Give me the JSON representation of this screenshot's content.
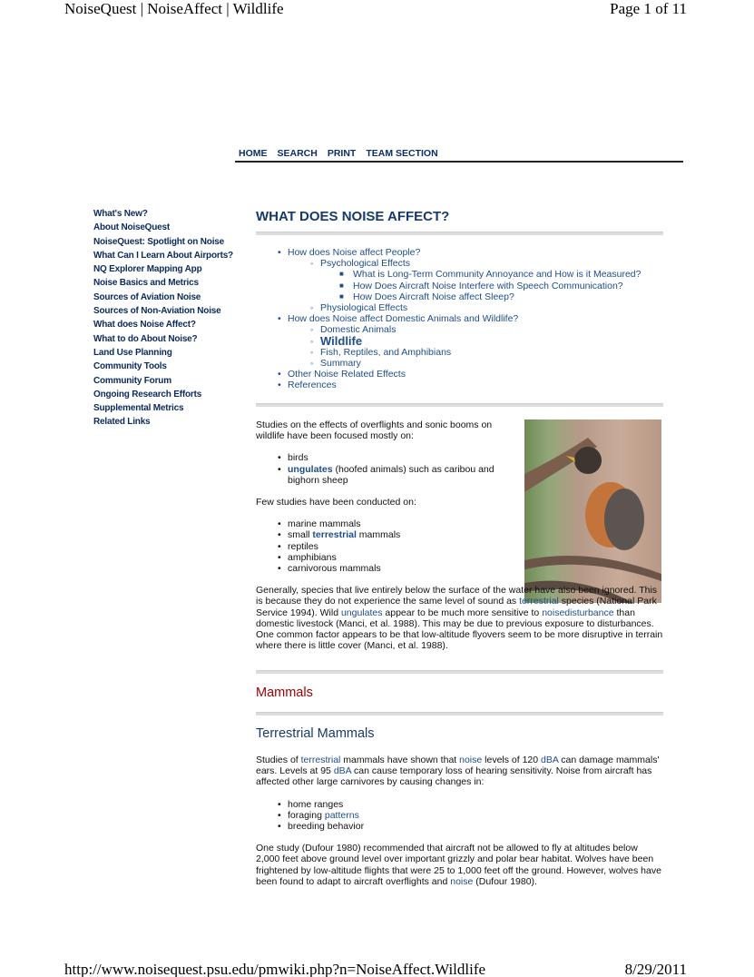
{
  "print_header": {
    "title": "NoiseQuest | NoiseAffect | Wildlife",
    "page": "Page 1 of 11"
  },
  "print_footer": {
    "url": "http://www.noisequest.psu.edu/pmwiki.php?n=NoiseAffect.Wildlife",
    "date": "8/29/2011"
  },
  "nav": [
    "HOME",
    "SEARCH",
    "PRINT",
    "TEAM SECTION"
  ],
  "sidebar": [
    "What's New?",
    "About NoiseQuest",
    "NoiseQuest: Spotlight on Noise",
    "What Can I Learn About Airports?",
    "NQ Explorer Mapping App",
    "Noise Basics and Metrics",
    "Sources of Aviation Noise",
    "Sources of Non-Aviation Noise",
    "What does Noise Affect?",
    "What to do About Noise?",
    "Land Use Planning",
    "Community Tools",
    "Community Forum",
    "Ongoing Research Efforts",
    "Supplemental Metrics",
    "Related Links"
  ],
  "main": {
    "title": "WHAT DOES NOISE AFFECT?",
    "toc": [
      {
        "level": 1,
        "text": "How does Noise affect People?"
      },
      {
        "level": 2,
        "text": "Psychological Effects"
      },
      {
        "level": 3,
        "text": "What is Long-Term Community Annoyance and How is it Measured?"
      },
      {
        "level": 3,
        "text": "How Does Aircraft Noise Interfere with Speech Communication?"
      },
      {
        "level": 3,
        "text": "How Does Aircraft Noise affect Sleep?"
      },
      {
        "level": 2,
        "text": "Physiological Effects"
      },
      {
        "level": 1,
        "text": "How does Noise affect Domestic Animals and Wildlife?"
      },
      {
        "level": 2,
        "text": "Domestic Animals"
      },
      {
        "level": 2,
        "text": "Wildlife",
        "current": true
      },
      {
        "level": 2,
        "text": "Fish, Reptiles, and Amphibians"
      },
      {
        "level": 2,
        "text": "Summary"
      },
      {
        "level": 1,
        "text": "Other Noise Related Effects"
      },
      {
        "level": 1,
        "text": "References"
      }
    ],
    "intro": "Studies on the effects of overflights and sonic booms on wildlife have been focused mostly on:",
    "focused": {
      "b1": "birds",
      "b2_link": "ungulates",
      "b2_rest": " (hoofed animals) such as caribou and bighorn sheep"
    },
    "few": "Few studies have been conducted on:",
    "few_list": {
      "i1": "marine mammals",
      "i2a": "small ",
      "i2_link": "terrestrial",
      "i2b": " mammals",
      "i3": "reptiles",
      "i4": "amphibians",
      "i5": "carnivorous mammals"
    },
    "generally": {
      "t1": "Generally, species that live entirely below the surface of the water have also been ignored. This is because they do not experience the same level of sound as ",
      "l1": "terrestrial",
      "t2": " species (National Park Service 1994). Wild ",
      "l2": "ungulates",
      "t3": " appear to be much more sensitive to ",
      "l3": "noisedisturbance",
      "t4": " than domestic livestock (Manci, et al. 1988). This may be due to previous exposure to disturbances. One common factor appears to be that low-altitude flyovers seem to be more disruptive in terrain where there is little cover (Manci, et al. 1988)."
    },
    "mammals_heading": "Mammals",
    "terrestrial_heading": "Terrestrial Mammals",
    "tm_para": {
      "t1": "Studies of ",
      "l1": "terrestrial",
      "t2": " mammals have shown that ",
      "l2": "noise",
      "t3": " levels of 120 ",
      "l3": "dBA",
      "t4": " can damage mammals' ears. Levels at 95 ",
      "l4": "dBA",
      "t5": " can cause temporary loss of hearing sensitivity. Noise from aircraft has affected other large carnivores by causing changes in:"
    },
    "changes": {
      "c1": "home ranges",
      "c2a": "foraging ",
      "c2_link": "patterns",
      "c3": "breeding behavior"
    },
    "dufour": {
      "t1": "One study (Dufour 1980) recommended that aircraft not be allowed to fly at altitudes below 2,000 feet above ground level over important grizzly and polar bear habitat. Wolves have been frightened by low-altitude flights that were 25 to 1,000 feet off the ground. However, wolves have been found to adapt to aircraft overflights and ",
      "l1": "noise",
      "t2": " (Dufour 1980)."
    }
  },
  "colors": {
    "heading": "#17396b",
    "link": "#1e4d8a",
    "mammals": "#a60000"
  }
}
